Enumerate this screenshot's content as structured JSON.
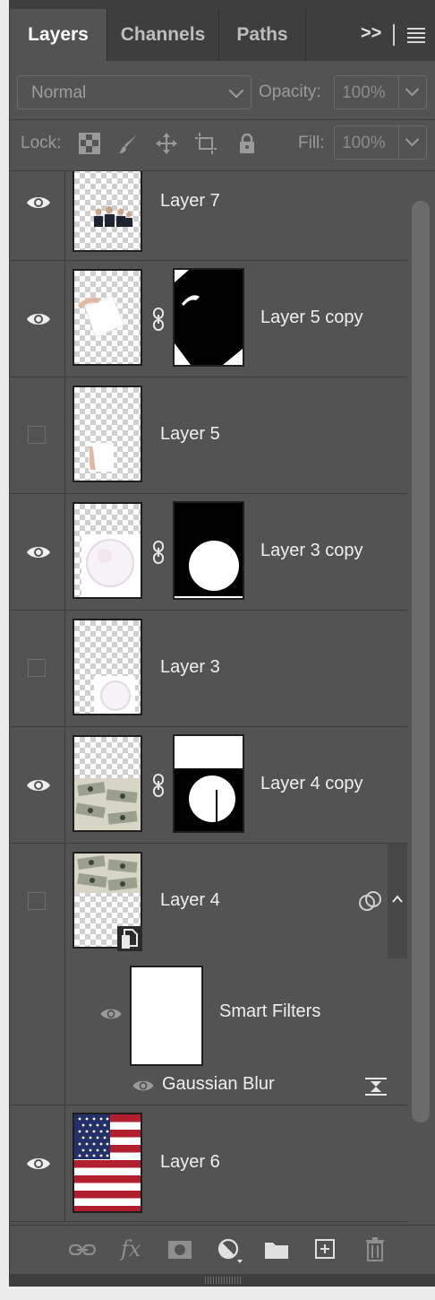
{
  "tabs": [
    {
      "label": "Layers",
      "active": true
    },
    {
      "label": "Channels",
      "active": false
    },
    {
      "label": "Paths",
      "active": false
    }
  ],
  "tab_overflow": ">>",
  "blend_mode": "Normal",
  "opacity": {
    "label": "Opacity:",
    "value": "100%"
  },
  "lock": {
    "label": "Lock:",
    "icons": [
      "lock-transparent-pixels-icon",
      "lock-image-pixels-icon",
      "lock-position-icon",
      "lock-artboard-icon",
      "lock-all-icon"
    ]
  },
  "fill": {
    "label": "Fill:",
    "value": "100%"
  },
  "layers": [
    {
      "name": "Layer 7",
      "visible": true
    },
    {
      "name": "Layer 5 copy",
      "visible": true,
      "has_mask": true
    },
    {
      "name": "Layer 5",
      "visible": false
    },
    {
      "name": "Layer 3 copy",
      "visible": true,
      "has_mask": true
    },
    {
      "name": "Layer 3",
      "visible": false
    },
    {
      "name": "Layer 4 copy",
      "visible": true,
      "has_mask": true
    },
    {
      "name": "Layer 4",
      "visible": false,
      "smart_object": true,
      "smart_filters": {
        "label": "Smart Filters",
        "filters": [
          {
            "name": "Gaussian Blur"
          }
        ]
      }
    },
    {
      "name": "Layer 6",
      "visible": true
    }
  ],
  "footer_icons": [
    "link-layers-icon",
    "fx-icon",
    "add-mask-icon",
    "adjustment-layer-icon",
    "new-group-icon",
    "new-layer-icon",
    "delete-layer-icon"
  ],
  "colors": {
    "panel": "#535353",
    "tabbar": "#3e3e3e",
    "text": "#efefef"
  }
}
